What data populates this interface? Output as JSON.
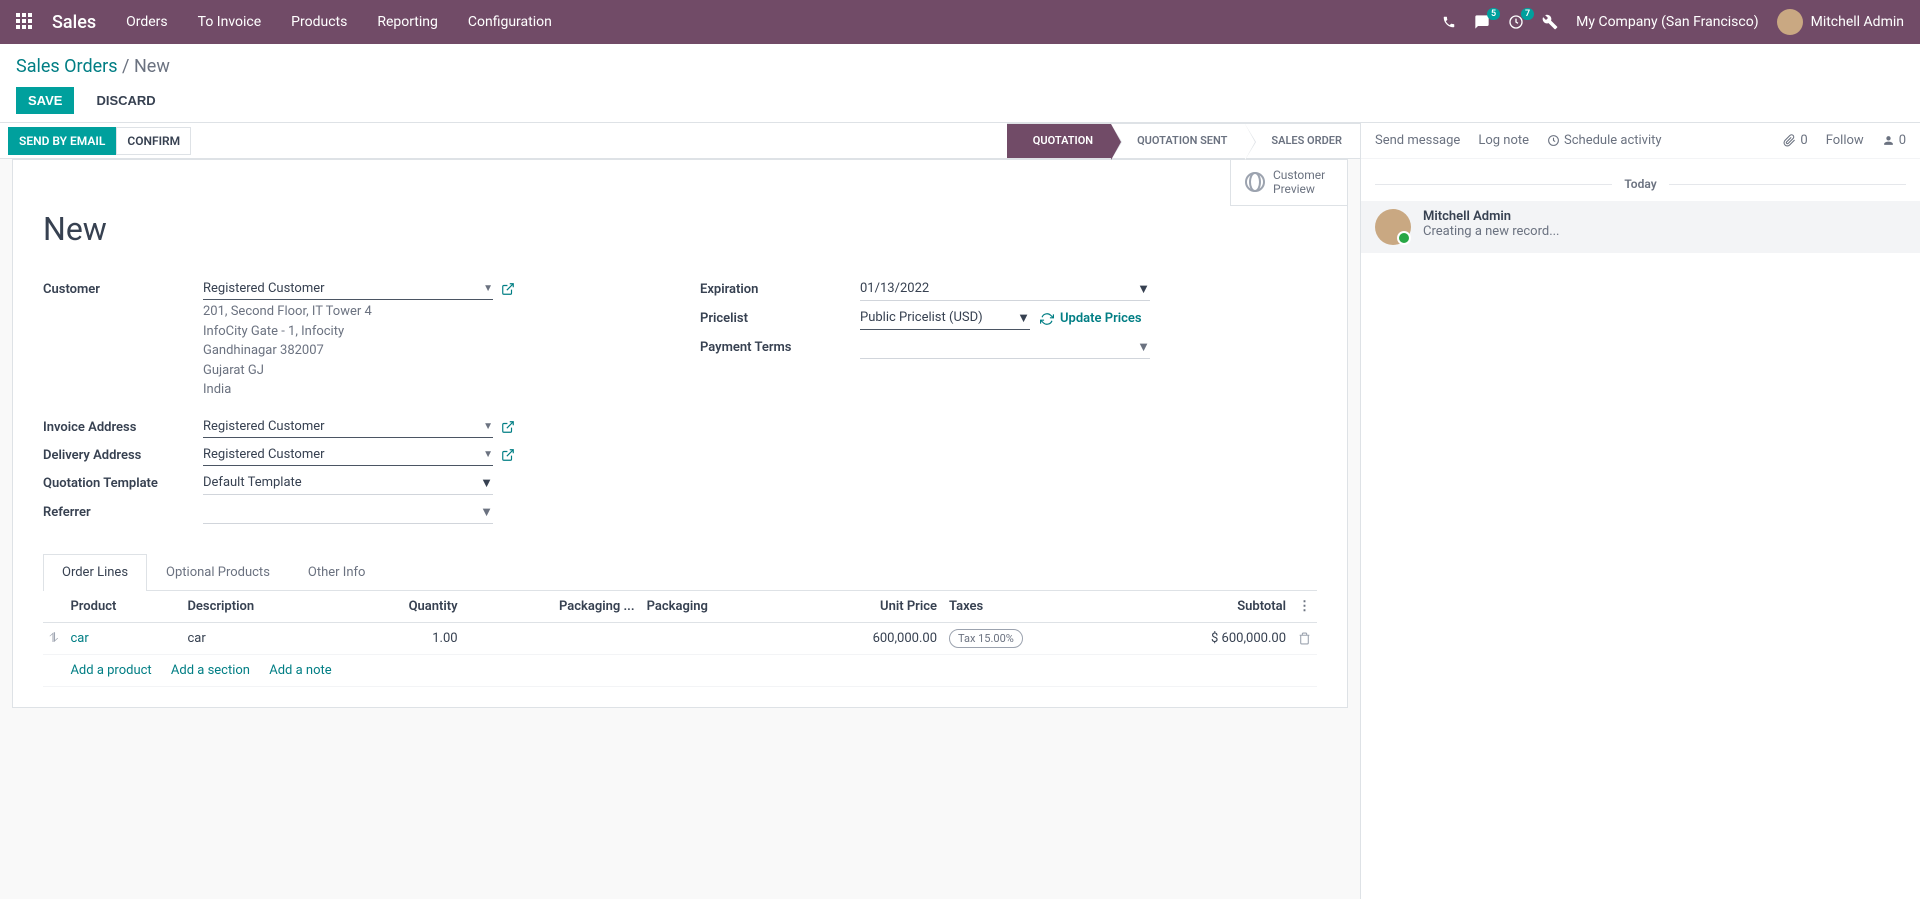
{
  "topnav": {
    "brand": "Sales",
    "menu": [
      "Orders",
      "To Invoice",
      "Products",
      "Reporting",
      "Configuration"
    ],
    "msg_badge": "5",
    "clock_badge": "7",
    "company": "My Company (San Francisco)",
    "user": "Mitchell Admin"
  },
  "breadcrumb": {
    "root": "Sales Orders",
    "current": "New"
  },
  "actions": {
    "save": "SAVE",
    "discard": "DISCARD"
  },
  "statusbar": {
    "send_email": "SEND BY EMAIL",
    "confirm": "CONFIRM",
    "stages": [
      "QUOTATION",
      "QUOTATION SENT",
      "SALES ORDER"
    ],
    "active_idx": 0
  },
  "sheet": {
    "cust_preview": "Customer Preview",
    "title": "New",
    "left": {
      "customer_label": "Customer",
      "customer_val": "Registered Customer",
      "address": [
        "201, Second Floor, IT Tower 4",
        "InfoCity Gate - 1, Infocity",
        "Gandhinagar 382007",
        "Gujarat GJ",
        "India"
      ],
      "invoice_label": "Invoice Address",
      "invoice_val": "Registered Customer",
      "delivery_label": "Delivery Address",
      "delivery_val": "Registered Customer",
      "template_label": "Quotation Template",
      "template_val": "Default Template",
      "referrer_label": "Referrer",
      "referrer_val": ""
    },
    "right": {
      "expiration_label": "Expiration",
      "expiration_val": "01/13/2022",
      "pricelist_label": "Pricelist",
      "pricelist_val": "Public Pricelist (USD)",
      "update_prices": "Update Prices",
      "payment_label": "Payment Terms",
      "payment_val": ""
    }
  },
  "tabs": [
    "Order Lines",
    "Optional Products",
    "Other Info"
  ],
  "table": {
    "headers": [
      "Product",
      "Description",
      "Quantity",
      "Packaging ...",
      "Packaging",
      "Unit Price",
      "Taxes",
      "Subtotal"
    ],
    "row": {
      "product": "car",
      "description": "car",
      "qty": "1.00",
      "pkg_qty": "",
      "pkg": "",
      "unit_price": "600,000.00",
      "tax": "Tax 15.00%",
      "subtotal": "$ 600,000.00"
    },
    "add": {
      "product": "Add a product",
      "section": "Add a section",
      "note": "Add a note"
    }
  },
  "chatter": {
    "send": "Send message",
    "log": "Log note",
    "schedule": "Schedule activity",
    "attach_cnt": "0",
    "follow": "Follow",
    "follow_cnt": "0",
    "today": "Today",
    "msg": {
      "author": "Mitchell Admin",
      "text": "Creating a new record..."
    }
  }
}
